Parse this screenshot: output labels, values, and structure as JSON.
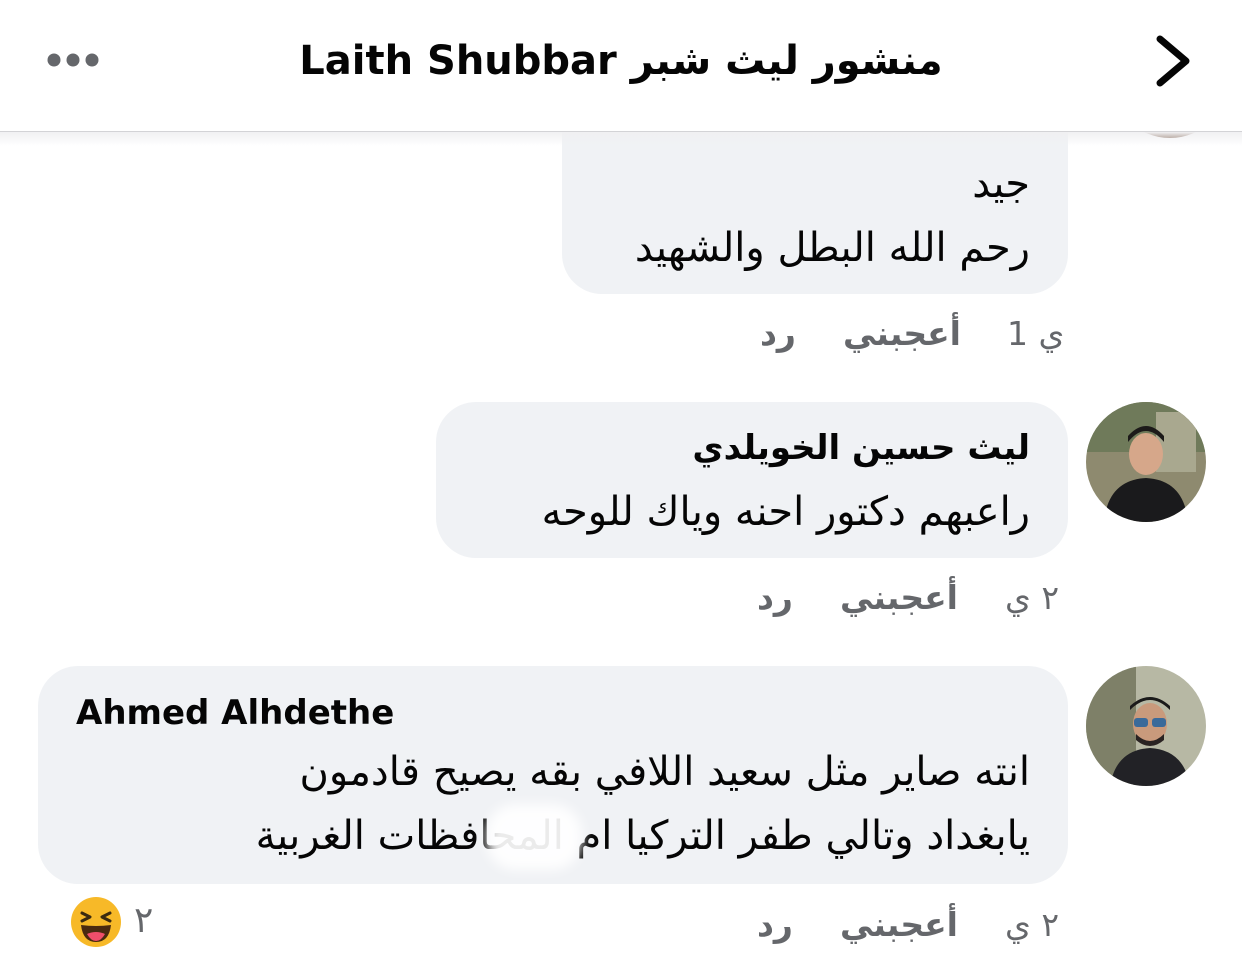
{
  "header": {
    "title": "منشور ليث شبر Laith Shubbar",
    "more_icon": "more-horizontal-icon",
    "back_icon": "chevron-right-icon"
  },
  "comments": [
    {
      "lines": [
        "جيد",
        "رحم الله البطل والشهيد"
      ],
      "time": "1 ي",
      "like_label": "أعجبني",
      "reply_label": "رد"
    },
    {
      "author": "ليث حسين الخويلدي",
      "lines": [
        "راعبهم دكتور احنه وياك للوحه"
      ],
      "time": "٢ ي",
      "like_label": "أعجبني",
      "reply_label": "رد"
    },
    {
      "author": "Ahmed Alhdethe",
      "lines": [
        "انته صاير مثل سعيد اللافي بقه يصيح قادمون",
        "يابغداد وتالي طفر التركيا     ام المحافظات الغربية"
      ],
      "time": "٢ ي",
      "like_label": "أعجبني",
      "reply_label": "رد",
      "reaction_icon": "laughing-emoji-icon",
      "reaction_count": "٢"
    }
  ],
  "colors": {
    "bubble": "#f0f2f5",
    "meta_text": "#65676b",
    "text": "#050505"
  }
}
